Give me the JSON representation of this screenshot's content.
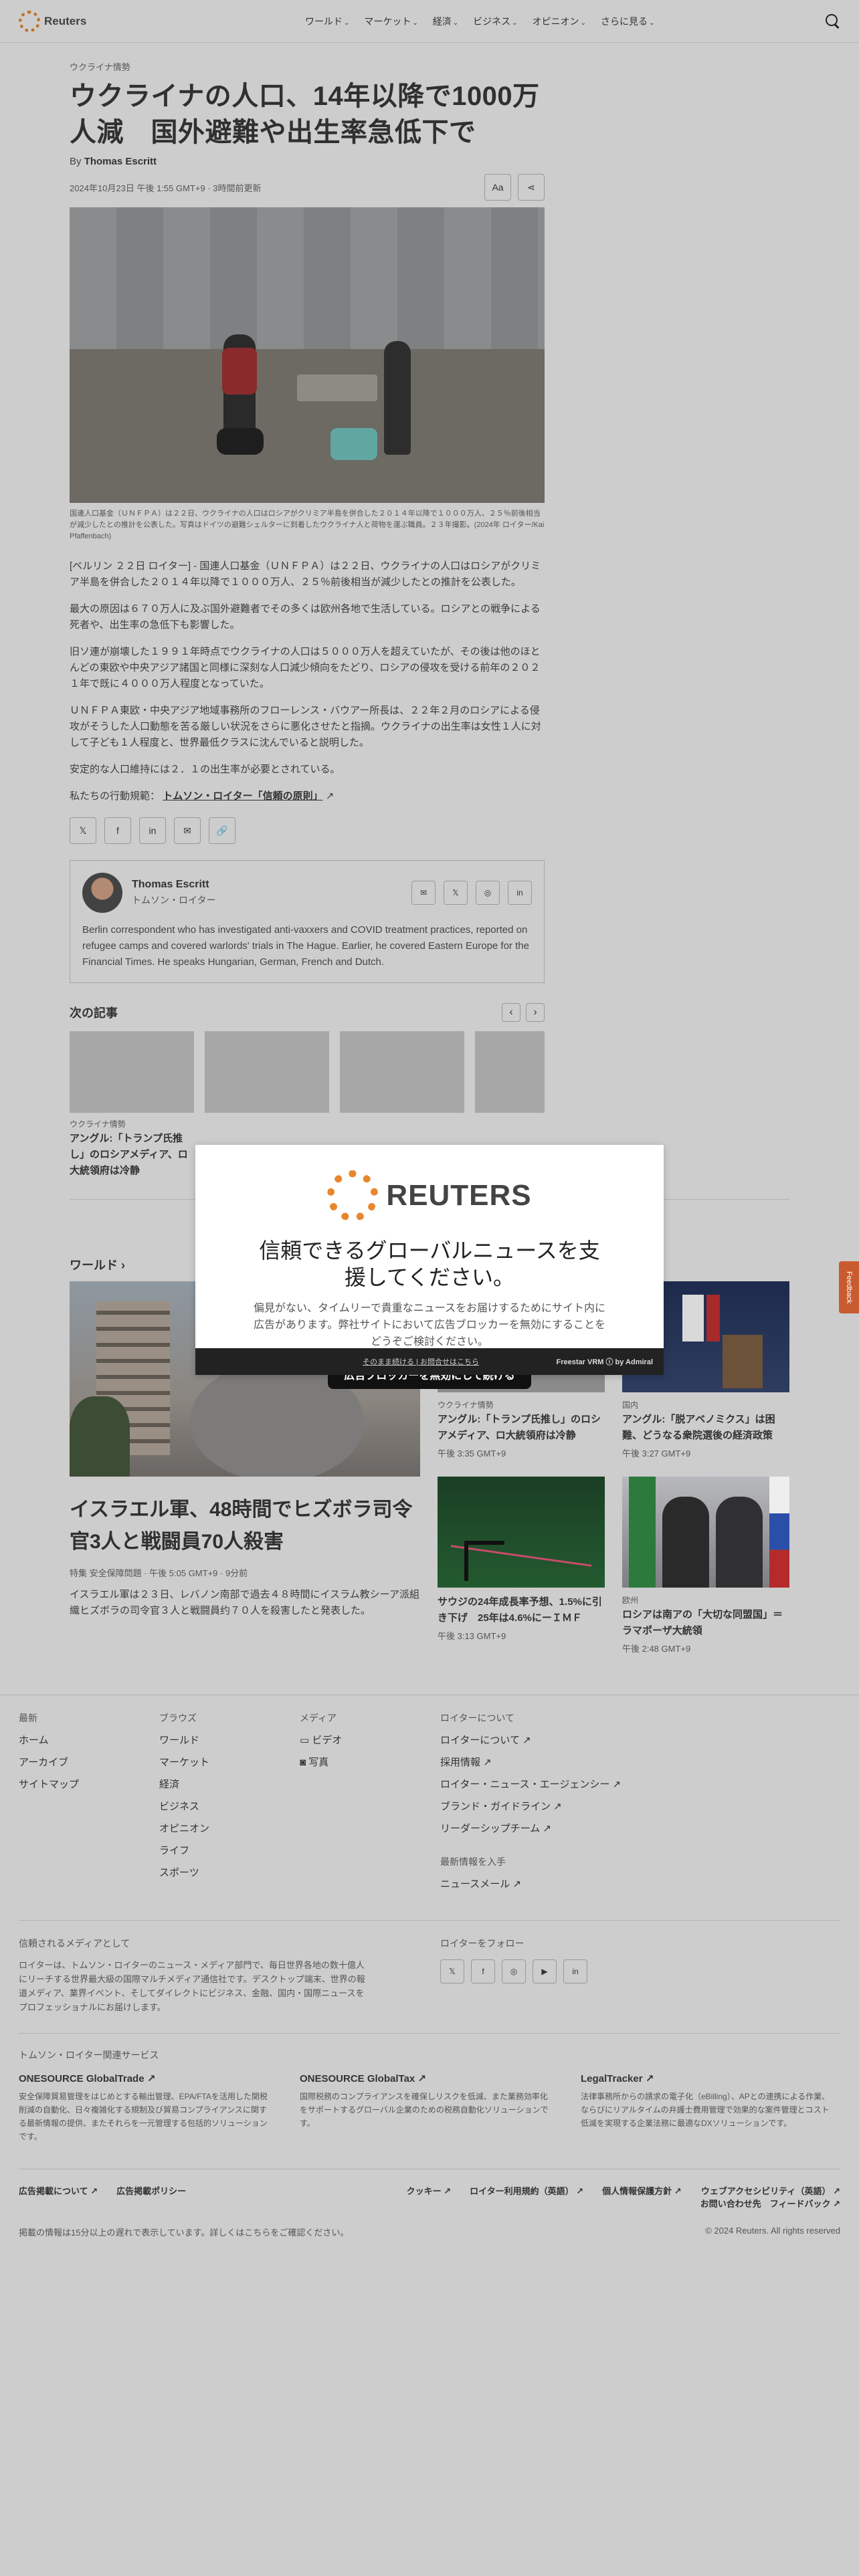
{
  "header": {
    "logo": "Reuters",
    "nav": [
      "ワールド",
      "マーケット",
      "経済",
      "ビジネス",
      "オピニオン",
      "さらに見る"
    ]
  },
  "article": {
    "kicker": "ウクライナ情勢",
    "headline": "ウクライナの人口、14年以降で1000万人減　国外避難や出生率急低下で",
    "byline_prefix": "By",
    "author": "Thomas Escritt",
    "date": "2024年10月23日 午後 1:55 GMT+9 · 3時間前更新",
    "text_size_label": "Aa",
    "caption": "国連人口基金（ＵＮＦＰＡ）は２２日、ウクライナの人口はロシアがクリミア半島を併合した２０１４年以降で１０００万人、２５％前後相当が減少したとの推計を公表した。写真はドイツの避難シェルターに到着したウクライナ人と荷物を運ぶ職員。２３年撮影。(2024年 ロイター/Kai Pfaffenbach)",
    "paragraphs": [
      "[ベルリン ２２日 ロイター] - 国連人口基金（ＵＮＦＰＡ）は２２日、ウクライナの人口はロシアがクリミア半島を併合した２０１４年以降で１０００万人、２５％前後相当が減少したとの推計を公表した。",
      "最大の原因は６７０万人に及ぶ国外避難者でその多くは欧州各地で生活している。ロシアとの戦争による死者や、出生率の急低下も影響した。",
      "旧ソ連が崩壊した１９９１年時点でウクライナの人口は５０００万人を超えていたが、その後は他のほとんどの東欧や中央アジア諸国と同様に深刻な人口減少傾向をたどり、ロシアの侵攻を受ける前年の２０２１年で既に４０００万人程度となっていた。",
      "ＵＮＦＰＡ東欧・中央アジア地域事務所のフローレンス・バウアー所長は、２２年２月のロシアによる侵攻がそうした人口動態を苦る厳しい状況をさらに悪化させたと指摘。ウクライナの出生率は女性１人に対して子ども１人程度と、世界最低クラスに沈んでいると説明した。",
      "安定的な人口維持には２．１の出生率が必要とされている。"
    ],
    "trust_prefix": "私たちの行動規範：",
    "trust_link": "トムソン・ロイター「信頼の原則」",
    "share_icons": [
      "x-icon",
      "facebook-icon",
      "linkedin-icon",
      "email-icon",
      "link-icon"
    ]
  },
  "author_box": {
    "name": "Thomas Escritt",
    "role": "トムソン・ロイター",
    "bio": "Berlin correspondent who has investigated anti-vaxxers and COVID treatment practices, reported on refugee camps and covered warlords' trials in The Hague. Earlier, he covered Eastern Europe for the Financial Times. He speaks Hungarian, German, French and Dutch."
  },
  "next": {
    "title": "次の記事",
    "cards": [
      {
        "kicker": "ウクライナ情勢",
        "title": "アングル:「トランプ氏推し」のロシアメディア、ロ大統領府は冷静"
      },
      {
        "kicker": "",
        "title": ""
      },
      {
        "kicker": "",
        "title": ""
      },
      {
        "kicker": "",
        "title": ""
      }
    ]
  },
  "world": {
    "title": "ワールド",
    "feature": {
      "title": "イスラエル軍、48時間でヒズボラ司令官3人と戦闘員70人殺害",
      "meta": "特集 安全保障問題 · 午後 5:05 GMT+9 · 9分前",
      "desc": "イスラエル軍は２３日、レバノン南部で過去４８時間にイスラム教シーア派組織ヒズボラの司令官３人と戦闘員约７０人を殺害したと発表した。"
    },
    "side": [
      {
        "kicker": "ウクライナ情勢",
        "title": "アングル:「トランプ氏推し」のロシアメディア、ロ大統領府は冷静",
        "time": "午後 3:35 GMT+9"
      },
      {
        "kicker": "国内",
        "title": "アングル:「脱アベノミクス」は困難、どうなる衆院選後の経済政策",
        "time": "午後 3:27 GMT+9"
      },
      {
        "kicker": "",
        "title": "サウジの24年成長率予想、1.5%に引き下げ　25年は4.6%にーＩＭＦ",
        "time": "午後 3:13 GMT+9"
      },
      {
        "kicker": "欧州",
        "title": "ロシアは南アの「大切な同盟国」＝ラマポーザ大統領",
        "time": "午後 2:48 GMT+9"
      }
    ]
  },
  "footer": {
    "cols": [
      {
        "head": "最新",
        "links": [
          "ホーム",
          "アーカイブ",
          "サイトマップ"
        ]
      },
      {
        "head": "ブラウズ",
        "links": [
          "ワールド",
          "マーケット",
          "経済",
          "ビジネス",
          "オピニオン",
          "ライフ",
          "スポーツ"
        ]
      },
      {
        "head": "メディア",
        "links": [
          "ビデオ",
          "写真"
        ]
      },
      {
        "head": "ロイターについて",
        "links": [
          "ロイターについて",
          "採用情報",
          "ロイター・ニュース・エージェンシー",
          "ブランド・ガイドライン",
          "リーダーシップチーム"
        ]
      }
    ],
    "latest_head": "最新情報を入手",
    "latest_link": "ニュースメール",
    "trusted_head": "信頼されるメディアとして",
    "trusted_text": "ロイターは、トムソン・ロイターのニュース・メディア部門で、毎日世界各地の数十億人にリーチする世界最大級の国際マルチメディア通信社です。デスクトップ端末、世界の報道メディア、業界イベント、そしてダイレクトにビジネス、金融、国内・国際ニュースをプロフェッショナルにお届けします。",
    "follow_head": "ロイターをフォロー",
    "services_head": "トムソン・ロイター関連サービス",
    "services": [
      {
        "name": "ONESOURCE GlobalTrade",
        "desc": "安全保障貿易管理をはじめとする輸出管理、EPA/FTAを活用した関税削減の自動化、日々複雑化する規制及び貿易コンプライアンスに関する最新情報の提供、またそれらを一元管理する包括的ソリューションです。"
      },
      {
        "name": "ONESOURCE GlobalTax",
        "desc": "国際税務のコンプライアンスを確保しリスクを低減、また業務効率化をサポートするグローバル企業のための税務自動化ソリューションです。"
      },
      {
        "name": "LegalTracker",
        "desc": "法律事務所からの請求の電子化（eBilling）、APとの連携による作業、ならびにリアルタイムの弁護士費用管理で効果的な案件管理とコスト低減を実現する企業法務に最適なDXソリューションです。"
      }
    ],
    "bottom_left": [
      "広告掲載について",
      "広告掲載ポリシー"
    ],
    "bottom_right": [
      "クッキー",
      "ロイター利用規約（英語）",
      "個人情報保護方針",
      "ウェブアクセシビリティ（英語）",
      "お問い合わせ先",
      "フィードバック"
    ],
    "note": "掲載の情報は15分以上の遅れで表示しています。詳しくはこちらをご確認ください。",
    "copyright": "© 2024 Reuters. All rights reserved"
  },
  "modal": {
    "logo": "REUTERS",
    "title": "信頼できるグローバルニュースを支援してください。",
    "desc": "偏見がない、タイムリーで貴重なニュースをお届けするためにサイト内に広告があります。弊社サイトにおいて広告ブロッカーを無効にすることをどうぞご検討ください。",
    "button": "広告ブロッカーを無効にして続ける",
    "bar_links": "そのまま続ける | お問合せはこちら",
    "bar_brand": "Freestar VRM ⓘ by Admiral"
  },
  "feedback": "Feedback"
}
